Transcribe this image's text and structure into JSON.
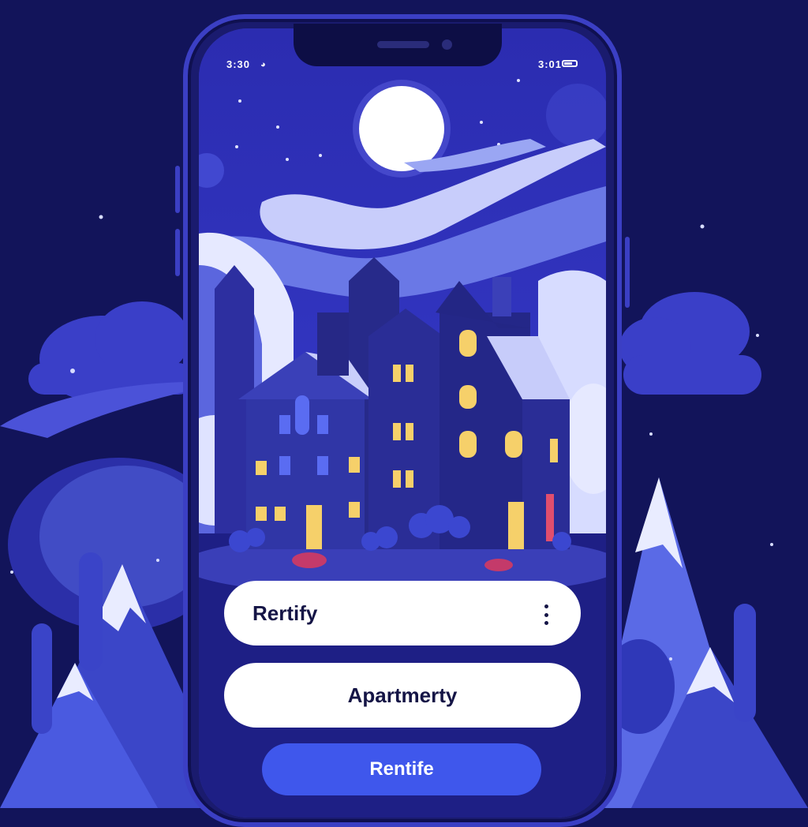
{
  "status_bar": {
    "time": "3:30",
    "right_text": "3:01"
  },
  "cards": [
    {
      "title": "Rertify"
    },
    {
      "title": "Apartmerty"
    }
  ],
  "cta": {
    "label": "Rentife"
  },
  "icons": {
    "wifi": "wifi-icon",
    "battery": "battery-icon",
    "menu": "kebab-menu-icon"
  },
  "colors": {
    "background": "#12145a",
    "screen": "#2a2ba8",
    "accent": "#3f57ec",
    "card": "#ffffff",
    "text": "#151546"
  }
}
